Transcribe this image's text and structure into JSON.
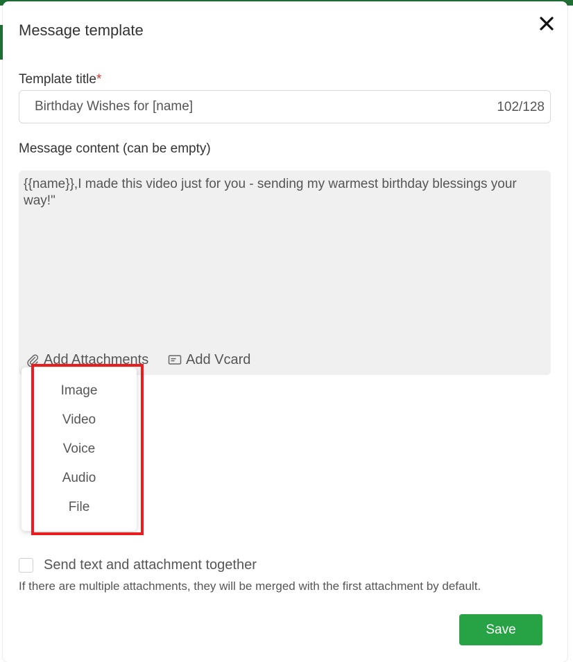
{
  "dialog": {
    "title": "Message template",
    "close_icon": "close-icon"
  },
  "template_title": {
    "label": "Template title",
    "required_mark": "*",
    "value": "Birthday Wishes for [name]",
    "char_count": "102/128"
  },
  "message_content": {
    "label": "Message content (can be empty)",
    "value": "{{name}},I made this video just for you - sending my warmest birthday blessings your way!\""
  },
  "toolbar": {
    "add_attachments": "Add Attachments",
    "add_attachments_icon": "paperclip-icon",
    "add_vcard": "Add Vcard",
    "add_vcard_icon": "vcard-icon"
  },
  "attachment_menu": {
    "items": [
      "Image",
      "Video",
      "Voice",
      "Audio",
      "File"
    ]
  },
  "send_together": {
    "label": "Send text and attachment together",
    "checked": false,
    "hint": "If there are multiple attachments, they will be merged with the first attachment by default."
  },
  "actions": {
    "save_label": "Save"
  },
  "colors": {
    "primary": "#27a244",
    "required": "#e0342b",
    "highlight": "#e81e1e"
  }
}
